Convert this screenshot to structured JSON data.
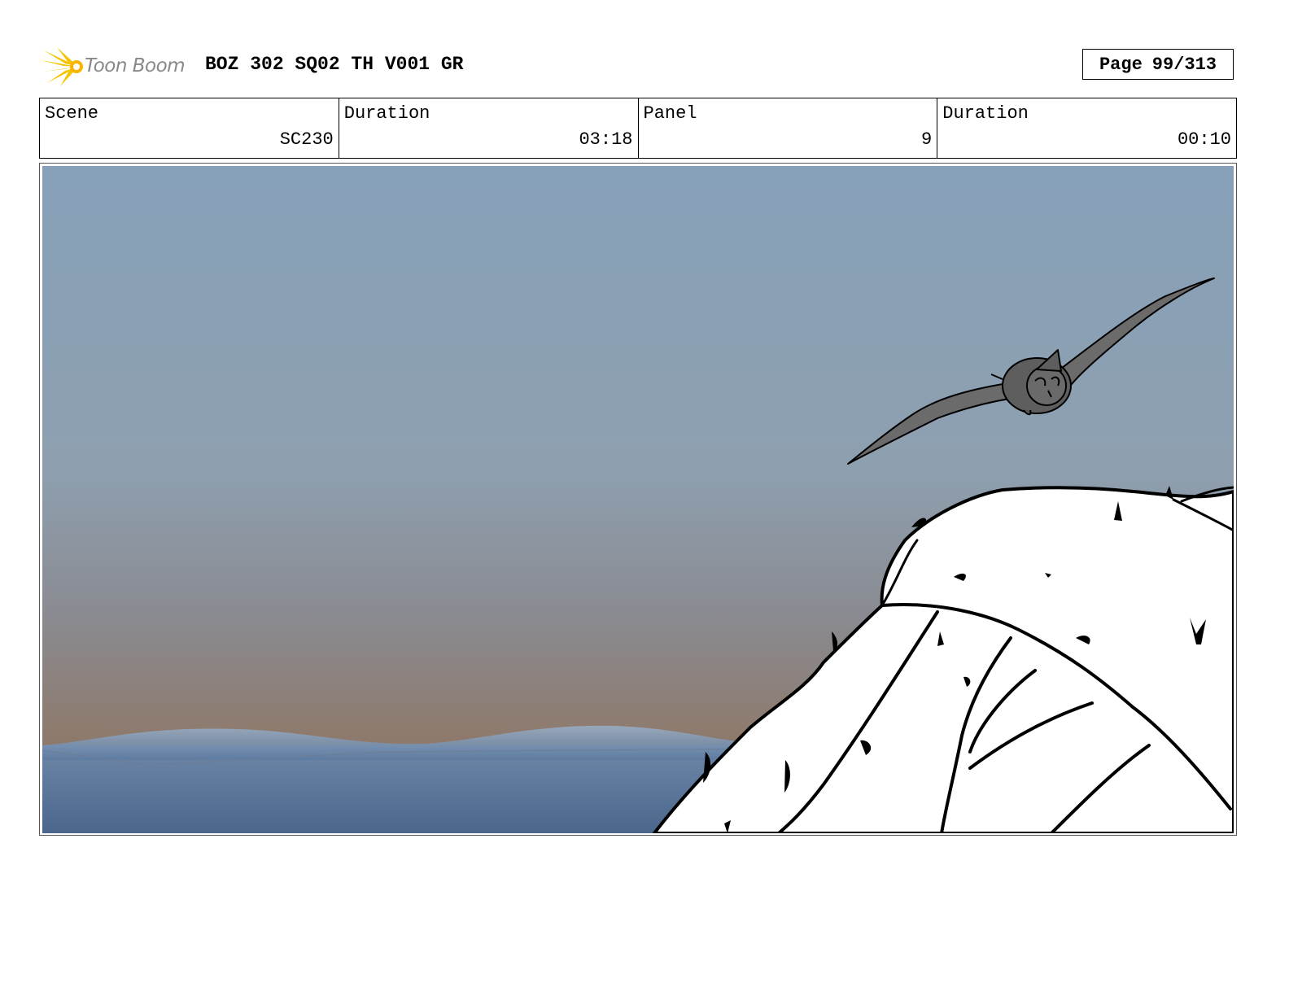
{
  "header": {
    "logo_text": "Toon Boom",
    "title": "BOZ 302 SQ02 TH V001 GR",
    "page_label": "Page",
    "page_number": "99/313"
  },
  "info": {
    "scene_label": "Scene",
    "scene_value": "SC230",
    "scene_duration_label": "Duration",
    "scene_duration_value": "03:18",
    "panel_label": "Panel",
    "panel_value": "9",
    "panel_duration_label": "Duration",
    "panel_duration_value": "00:10"
  },
  "colors": {
    "sky_top": "#86a0b8",
    "sky_horizon": "#8e7a6c",
    "sea": "#4e6a8e",
    "logo_yellow": "#f5c400",
    "bird_gray": "#6b6b6b"
  }
}
